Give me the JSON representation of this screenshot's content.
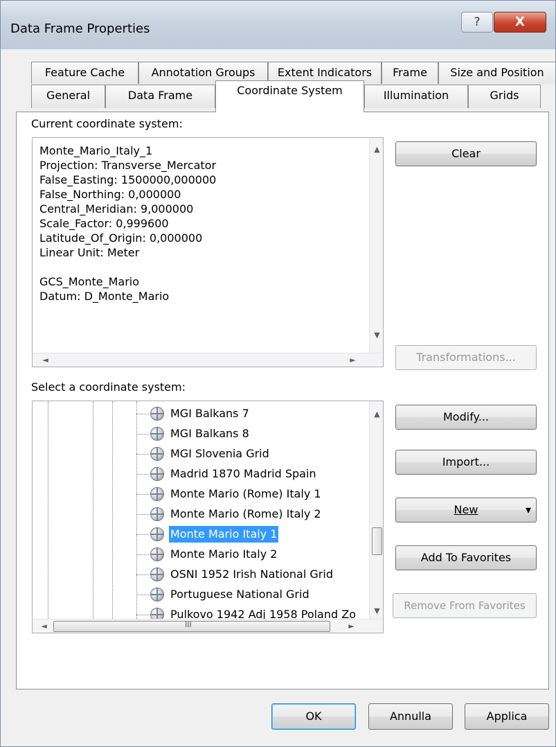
{
  "window": {
    "title": "Data Frame Properties",
    "help_glyph": "?",
    "close_glyph": "X"
  },
  "tabs_back": [
    "Feature Cache",
    "Annotation Groups",
    "Extent Indicators",
    "Frame",
    "Size and Position"
  ],
  "tabs_front": [
    "General",
    "Data Frame",
    "Coordinate System",
    "Illumination",
    "Grids"
  ],
  "active_tab": "Coordinate System",
  "current": {
    "label": "Current coordinate system:",
    "lines": [
      "Monte_Mario_Italy_1",
      "Projection: Transverse_Mercator",
      "False_Easting: 1500000,000000",
      "False_Northing: 0,000000",
      "Central_Meridian: 9,000000",
      "Scale_Factor: 0,999600",
      "Latitude_Of_Origin: 0,000000",
      "Linear Unit: Meter",
      "",
      "GCS_Monte_Mario",
      "Datum: D_Monte_Mario"
    ]
  },
  "select": {
    "label": "Select a coordinate system:",
    "items": [
      "MGI Balkans 7",
      "MGI Balkans 8",
      "MGI Slovenia Grid",
      "Madrid 1870 Madrid Spain",
      "Monte Mario (Rome) Italy 1",
      "Monte Mario (Rome) Italy 2",
      "Monte Mario Italy 1",
      "Monte Mario Italy 2",
      "OSNI 1952 Irish National Grid",
      "Portuguese National Grid",
      "Pulkovo 1942 Adj 1958 Poland Zo"
    ],
    "selected_index": 6,
    "hscroll_grip": "III"
  },
  "buttons": {
    "clear": "Clear",
    "transformations": "Transformations...",
    "modify": "Modify...",
    "import": "Import...",
    "new": "New",
    "add_favorites": "Add To Favorites",
    "remove_favorites": "Remove From Favorites",
    "ok": "OK",
    "cancel": "Annulla",
    "apply": "Applica"
  },
  "icons": {
    "scroll_up": "▲",
    "scroll_down": "▼",
    "scroll_left": "◄",
    "scroll_right": "►",
    "dropdown": "▾"
  }
}
